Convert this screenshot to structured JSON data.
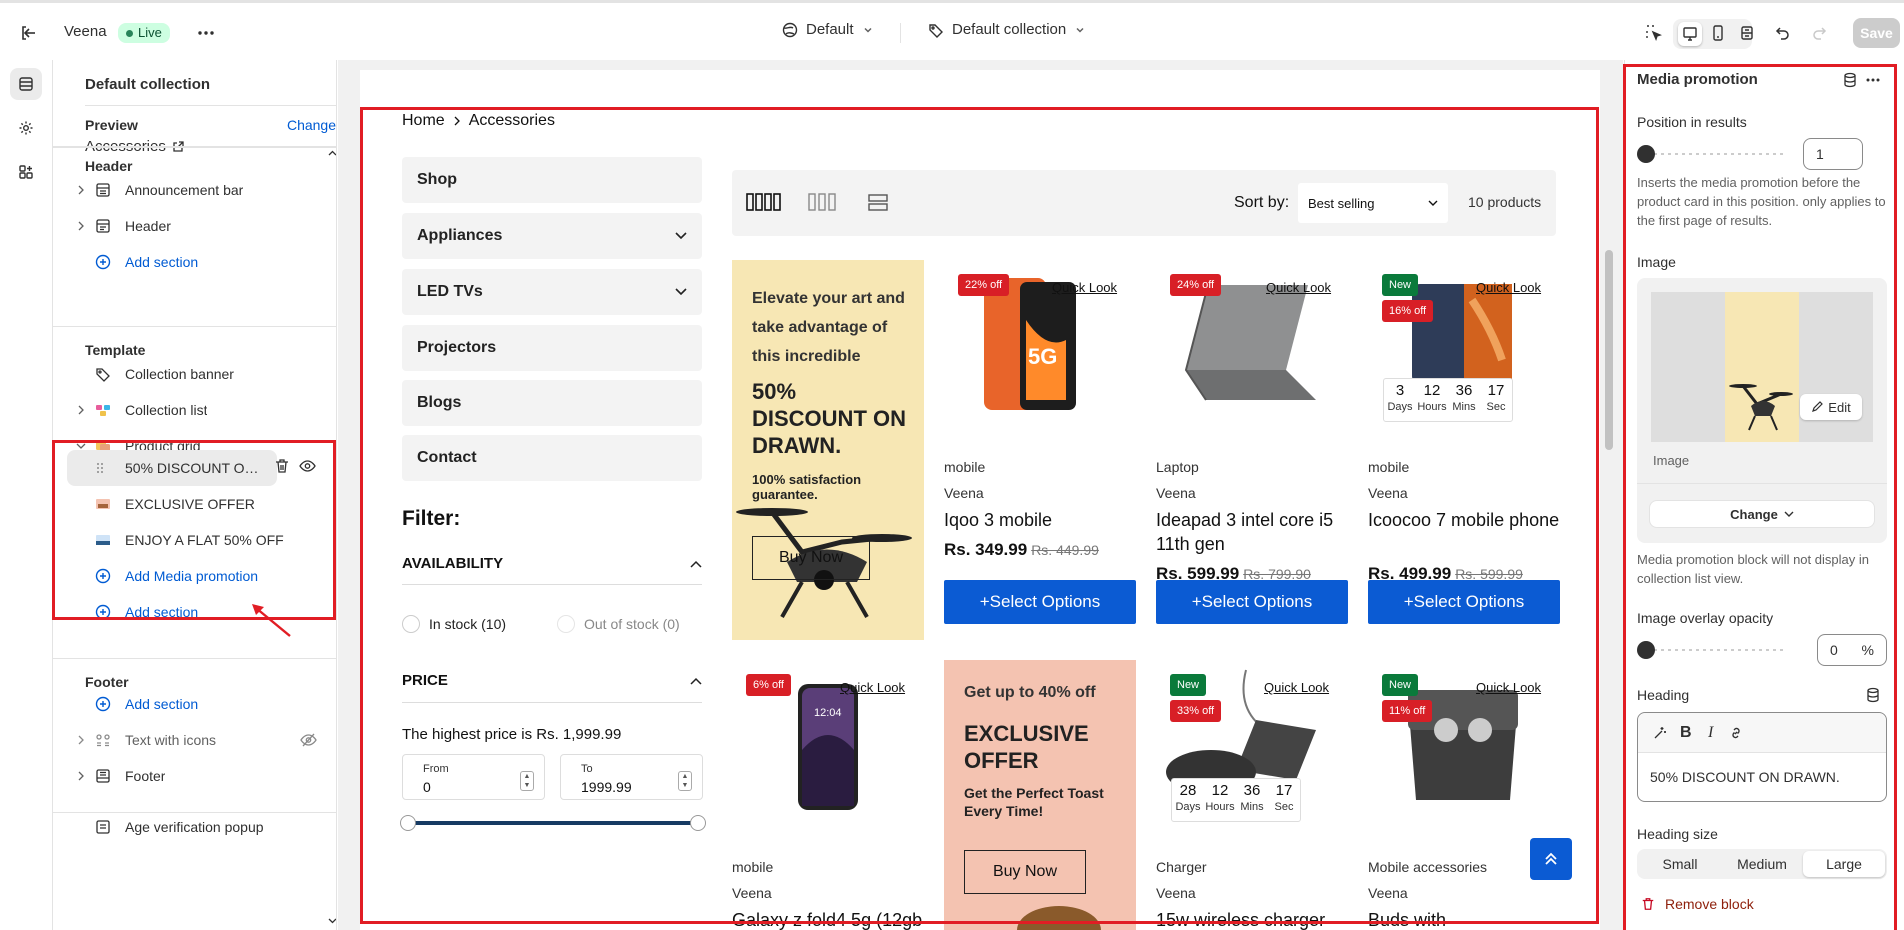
{
  "topbar": {
    "store_name": "Veena",
    "status_badge": "Live",
    "theme_selector": "Default",
    "template_selector": "Default collection",
    "save_label": "Save"
  },
  "sidebar": {
    "title": "Default collection",
    "preview": {
      "label": "Preview",
      "value": "Accessories",
      "change_label": "Change"
    },
    "header_group": {
      "title": "Header",
      "items": [
        {
          "label": "Announcement bar",
          "icon": "layout-rows-icon"
        },
        {
          "label": "Header",
          "icon": "layout-header-icon"
        }
      ],
      "add_label": "Add section"
    },
    "template_group": {
      "title": "Template",
      "items": [
        {
          "label": "Collection banner",
          "icon": "tag-icon"
        },
        {
          "label": "Collection list",
          "icon": "collection-list-icon"
        },
        {
          "label": "Product grid",
          "icon": "product-grid-icon"
        }
      ],
      "blocks": [
        {
          "label": "50% DISCOUNT ON DRAWN.",
          "icon": "drag-handle-icon"
        },
        {
          "label": "EXCLUSIVE OFFER",
          "icon": "image-thumb-icon"
        },
        {
          "label": "ENJOY A FLAT 50% OFF",
          "icon": "image-thumb-icon"
        }
      ],
      "add_block_label": "Add Media promotion",
      "add_label": "Add section"
    },
    "footer_group": {
      "title": "Footer",
      "add_label": "Add section",
      "items": [
        {
          "label": "Text with icons",
          "icon": "text-icons-icon"
        },
        {
          "label": "Footer",
          "icon": "layout-footer-icon"
        }
      ]
    },
    "age_popup": "Age verification popup"
  },
  "storefront": {
    "breadcrumb": [
      "Home",
      "Accessories"
    ],
    "nav": [
      {
        "label": "Shop",
        "has_chevron": false
      },
      {
        "label": "Appliances",
        "has_chevron": true
      },
      {
        "label": "LED TVs",
        "has_chevron": true
      },
      {
        "label": "Projectors",
        "has_chevron": false
      },
      {
        "label": "Blogs",
        "has_chevron": false
      },
      {
        "label": "Contact",
        "has_chevron": false
      }
    ],
    "filter": {
      "title": "Filter:",
      "availability": "AVAILABILITY",
      "in_stock": "In stock (10)",
      "out_of_stock": "Out of stock (0)",
      "price_title": "PRICE",
      "highest_price": "The highest price is Rs. 1,999.99",
      "from_label": "From",
      "from_value": "0",
      "to_label": "To",
      "to_value": "1999.99"
    },
    "toolbar": {
      "sort_label": "Sort by:",
      "sort_value": "Best selling",
      "count": "10 products"
    },
    "promo1": {
      "text": "Elevate your art and take advantage of this incredible",
      "heading": "50% DISCOUNT ON DRAWN.",
      "sub": "100% satisfaction guarantee.",
      "button": "Buy Now"
    },
    "promo2": {
      "text": "Get up to 40% off",
      "heading": "EXCLUSIVE OFFER",
      "sub": "Get the Perfect Toast Every Time!",
      "button": "Buy Now"
    },
    "quick_look": "Quick Look",
    "select_options": "+Select Options",
    "countdown_labels": [
      "Days",
      "Hours",
      "Mins",
      "Sec"
    ],
    "products": [
      {
        "badge": "22% off",
        "new": false,
        "category": "mobile",
        "vendor": "Veena",
        "title": "Iqoo 3 mobile",
        "price": "Rs. 349.99",
        "compare": "Rs. 449.99"
      },
      {
        "badge": "24% off",
        "new": false,
        "category": "Laptop",
        "vendor": "Veena",
        "title": "Ideapad 3 intel core i5 11th gen",
        "price": "Rs. 599.99",
        "compare": "Rs. 799.90"
      },
      {
        "badge": "16% off",
        "new": true,
        "new_label": "New",
        "category": "mobile",
        "vendor": "Veena",
        "title": "Icoocoo 7 mobile phone",
        "price": "Rs. 499.99",
        "compare": "Rs. 599.99",
        "countdown": [
          "3",
          "12",
          "36",
          "17"
        ]
      },
      {
        "badge": "6% off",
        "new": false,
        "category": "mobile",
        "vendor": "Veena",
        "title": "Galaxy z fold4 5g (12gb"
      },
      {
        "badge": "33% off",
        "new": true,
        "new_label": "New",
        "category": "Charger",
        "vendor": "Veena",
        "title": "15w wireless charger",
        "countdown": [
          "28",
          "12",
          "36",
          "17"
        ]
      },
      {
        "badge": "11% off",
        "new": true,
        "new_label": "New",
        "category": "Mobile accessories",
        "vendor": "Veena",
        "title": "Buds with"
      }
    ],
    "phone_time": "12:04",
    "phone_text": "5G"
  },
  "panel": {
    "title": "Media promotion",
    "position_label": "Position in results",
    "position_value": "1",
    "position_help": "Inserts the media promotion before the product card in this position. only applies to the first page of results.",
    "position_fraction": 0,
    "image_label": "Image",
    "image_caption": "Image",
    "edit_label": "Edit",
    "change_label": "Change",
    "image_help": "Media promotion block will not display in collection list view.",
    "opacity_label": "Image overlay opacity",
    "opacity_value": "0",
    "opacity_unit": "%",
    "heading_label": "Heading",
    "heading_value": "50% DISCOUNT ON DRAWN.",
    "heading_size_label": "Heading size",
    "sizes": [
      "Small",
      "Medium",
      "Large"
    ],
    "selected_size": "Large",
    "remove_label": "Remove block"
  },
  "colors": {
    "accent": "#005bd3",
    "highlight_red": "#e11d24",
    "promo1_bg": "#f7e7b4",
    "promo2_bg": "#f4c3b1",
    "select_btn": "#0b5bd3"
  }
}
